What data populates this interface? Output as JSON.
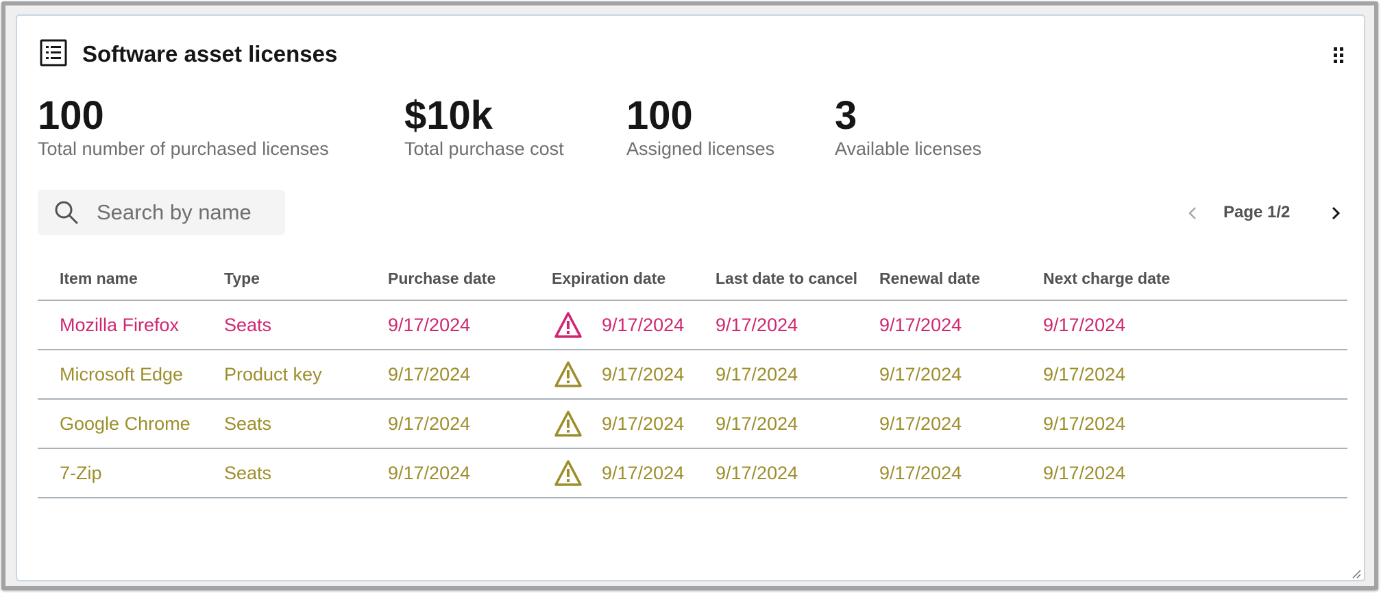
{
  "card": {
    "title": "Software asset licenses",
    "title_icon": "list-icon",
    "menu_icon": "grip-icon"
  },
  "stats": [
    {
      "value": "100",
      "label": "Total number of purchased licenses"
    },
    {
      "value": "$10k",
      "label": "Total purchase cost"
    },
    {
      "value": "100",
      "label": "Assigned licenses"
    },
    {
      "value": "3",
      "label": "Available licenses"
    }
  ],
  "search": {
    "placeholder": "Search by name",
    "value": "",
    "icon": "search-icon"
  },
  "pagination": {
    "label": "Page 1/2",
    "prev_icon": "chevron-left-icon",
    "next_icon": "chevron-right-icon"
  },
  "table": {
    "columns": [
      "Item name",
      "Type",
      "Purchase date",
      "Expiration date",
      "Last date to cancel",
      "Renewal date",
      "Next charge date"
    ],
    "rows": [
      {
        "name": "Mozilla Firefox",
        "type": "Seats",
        "purchase": "9/17/2024",
        "expiration": "9/17/2024",
        "cancel": "9/17/2024",
        "renewal": "9/17/2024",
        "next_charge": "9/17/2024",
        "status": "critical",
        "status_icon": "warning-triangle-icon"
      },
      {
        "name": "Microsoft Edge",
        "type": "Product key",
        "purchase": "9/17/2024",
        "expiration": "9/17/2024",
        "cancel": "9/17/2024",
        "renewal": "9/17/2024",
        "next_charge": "9/17/2024",
        "status": "warning",
        "status_icon": "warning-triangle-icon"
      },
      {
        "name": "Google Chrome",
        "type": "Seats",
        "purchase": "9/17/2024",
        "expiration": "9/17/2024",
        "cancel": "9/17/2024",
        "renewal": "9/17/2024",
        "next_charge": "9/17/2024",
        "status": "warning",
        "status_icon": "warning-triangle-icon"
      },
      {
        "name": "7-Zip",
        "type": "Seats",
        "purchase": "9/17/2024",
        "expiration": "9/17/2024",
        "cancel": "9/17/2024",
        "renewal": "9/17/2024",
        "next_charge": "9/17/2024",
        "status": "warning",
        "status_icon": "warning-triangle-icon"
      }
    ]
  },
  "colors": {
    "critical": "#d02670",
    "warning": "#9d8e2b",
    "text_primary": "#161616",
    "text_secondary": "#6f6f6f"
  },
  "resize_icon": "resize-handle-icon"
}
